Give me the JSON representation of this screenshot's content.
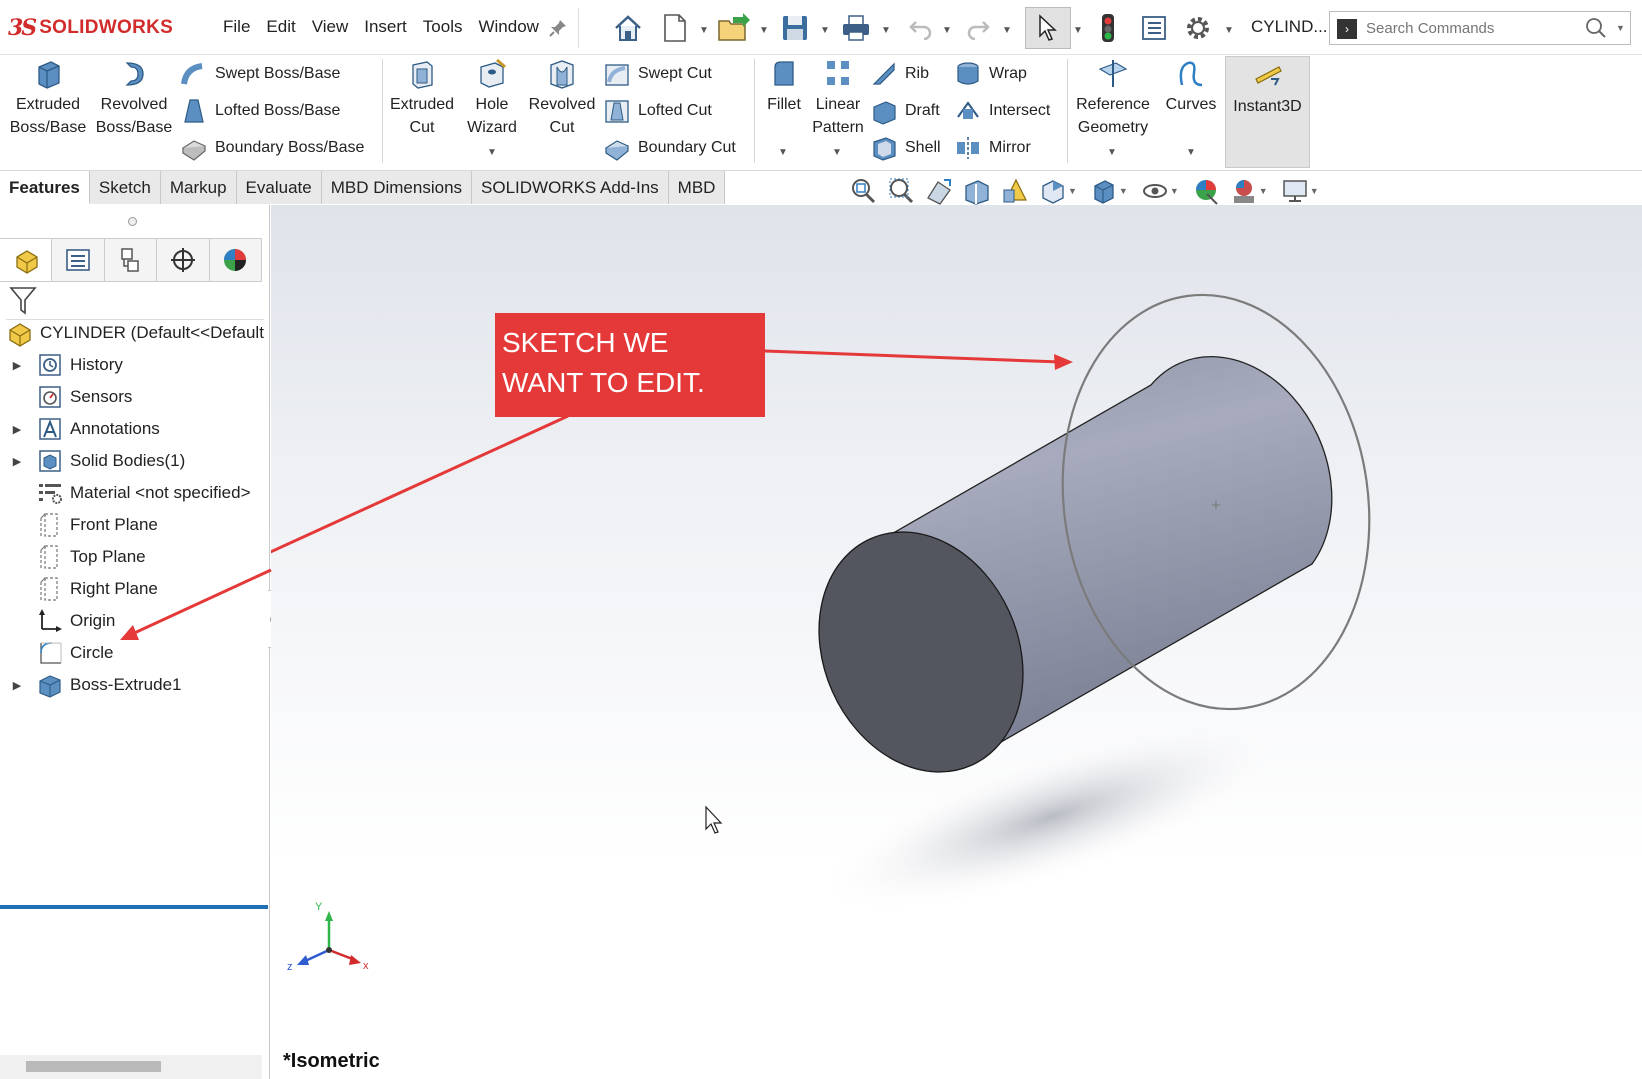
{
  "app": {
    "logo_ds": "3S",
    "brand": "SOLIDWORKS",
    "menus": [
      "File",
      "Edit",
      "View",
      "Insert",
      "Tools",
      "Window"
    ],
    "document_title": "CYLIND...",
    "search_placeholder": "Search Commands"
  },
  "ribbon": {
    "extruded_boss": [
      "Extruded",
      "Boss/Base"
    ],
    "revolved_boss": [
      "Revolved",
      "Boss/Base"
    ],
    "swept_boss": "Swept Boss/Base",
    "lofted_boss": "Lofted Boss/Base",
    "boundary_boss": "Boundary Boss/Base",
    "extruded_cut": [
      "Extruded",
      "Cut"
    ],
    "hole_wizard": [
      "Hole",
      "Wizard"
    ],
    "revolved_cut": [
      "Revolved",
      "Cut"
    ],
    "swept_cut": "Swept Cut",
    "lofted_cut": "Lofted Cut",
    "boundary_cut": "Boundary Cut",
    "fillet": "Fillet",
    "linear_pattern": [
      "Linear",
      "Pattern"
    ],
    "rib": "Rib",
    "draft": "Draft",
    "shell": "Shell",
    "wrap": "Wrap",
    "intersect": "Intersect",
    "mirror": "Mirror",
    "reference_geometry": [
      "Reference",
      "Geometry"
    ],
    "curves": "Curves",
    "instant3d": "Instant3D"
  },
  "tabs": [
    "Features",
    "Sketch",
    "Markup",
    "Evaluate",
    "MBD Dimensions",
    "SOLIDWORKS Add-Ins",
    "MBD"
  ],
  "tree": {
    "root": "CYLINDER  (Default<<Default",
    "items": [
      {
        "label": "History",
        "expandable": true,
        "icon": "history-icon"
      },
      {
        "label": "Sensors",
        "expandable": false,
        "icon": "sensor-icon"
      },
      {
        "label": "Annotations",
        "expandable": true,
        "icon": "annotation-icon"
      },
      {
        "label": "Solid Bodies(1)",
        "expandable": true,
        "icon": "solid-body-icon"
      },
      {
        "label": "Material <not specified>",
        "expandable": false,
        "icon": "material-icon"
      },
      {
        "label": "Front Plane",
        "expandable": false,
        "icon": "plane-icon"
      },
      {
        "label": "Top Plane",
        "expandable": false,
        "icon": "plane-icon"
      },
      {
        "label": "Right Plane",
        "expandable": false,
        "icon": "plane-icon"
      },
      {
        "label": "Origin",
        "expandable": false,
        "icon": "origin-icon"
      },
      {
        "label": "Circle",
        "expandable": false,
        "icon": "sketch-icon"
      },
      {
        "label": "Boss-Extrude1",
        "expandable": true,
        "icon": "extrude-feature-icon"
      }
    ]
  },
  "graphics": {
    "view_name": "*Isometric",
    "callout_lines": [
      "SKETCH WE",
      "WANT TO EDIT."
    ],
    "triad": {
      "x": "x",
      "y": "Y",
      "z": "z"
    }
  },
  "colors": {
    "brand_red": "#d22b2b",
    "callout_red": "#e53939",
    "rollback_blue": "#1f6fb5",
    "cylinder_side": "#9a9eb1",
    "cylinder_cap": "#52545f"
  }
}
